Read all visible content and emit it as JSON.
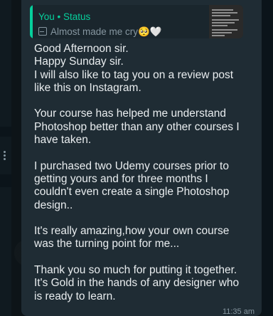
{
  "quote": {
    "sender": "You • Status",
    "status_text": "Almost made me cry🥺🤍"
  },
  "message": {
    "text": "Good Afternoon sir.\nHappy Sunday sir.\nI will also like to tag you on a review post like this on Instagram.\n\nYour course has helped me understand Photoshop better than any other courses I have taken.\n\nI purchased two Udemy courses prior to getting yours and for three months I couldn't even create a single Photoshop design..\n\nIt's really amazing,how your own course was the turning point for me...\n\nThank you so much for putting it together.\nIt's Gold in the hands of any designer who is ready to learn.",
    "time": "11:35 am"
  }
}
